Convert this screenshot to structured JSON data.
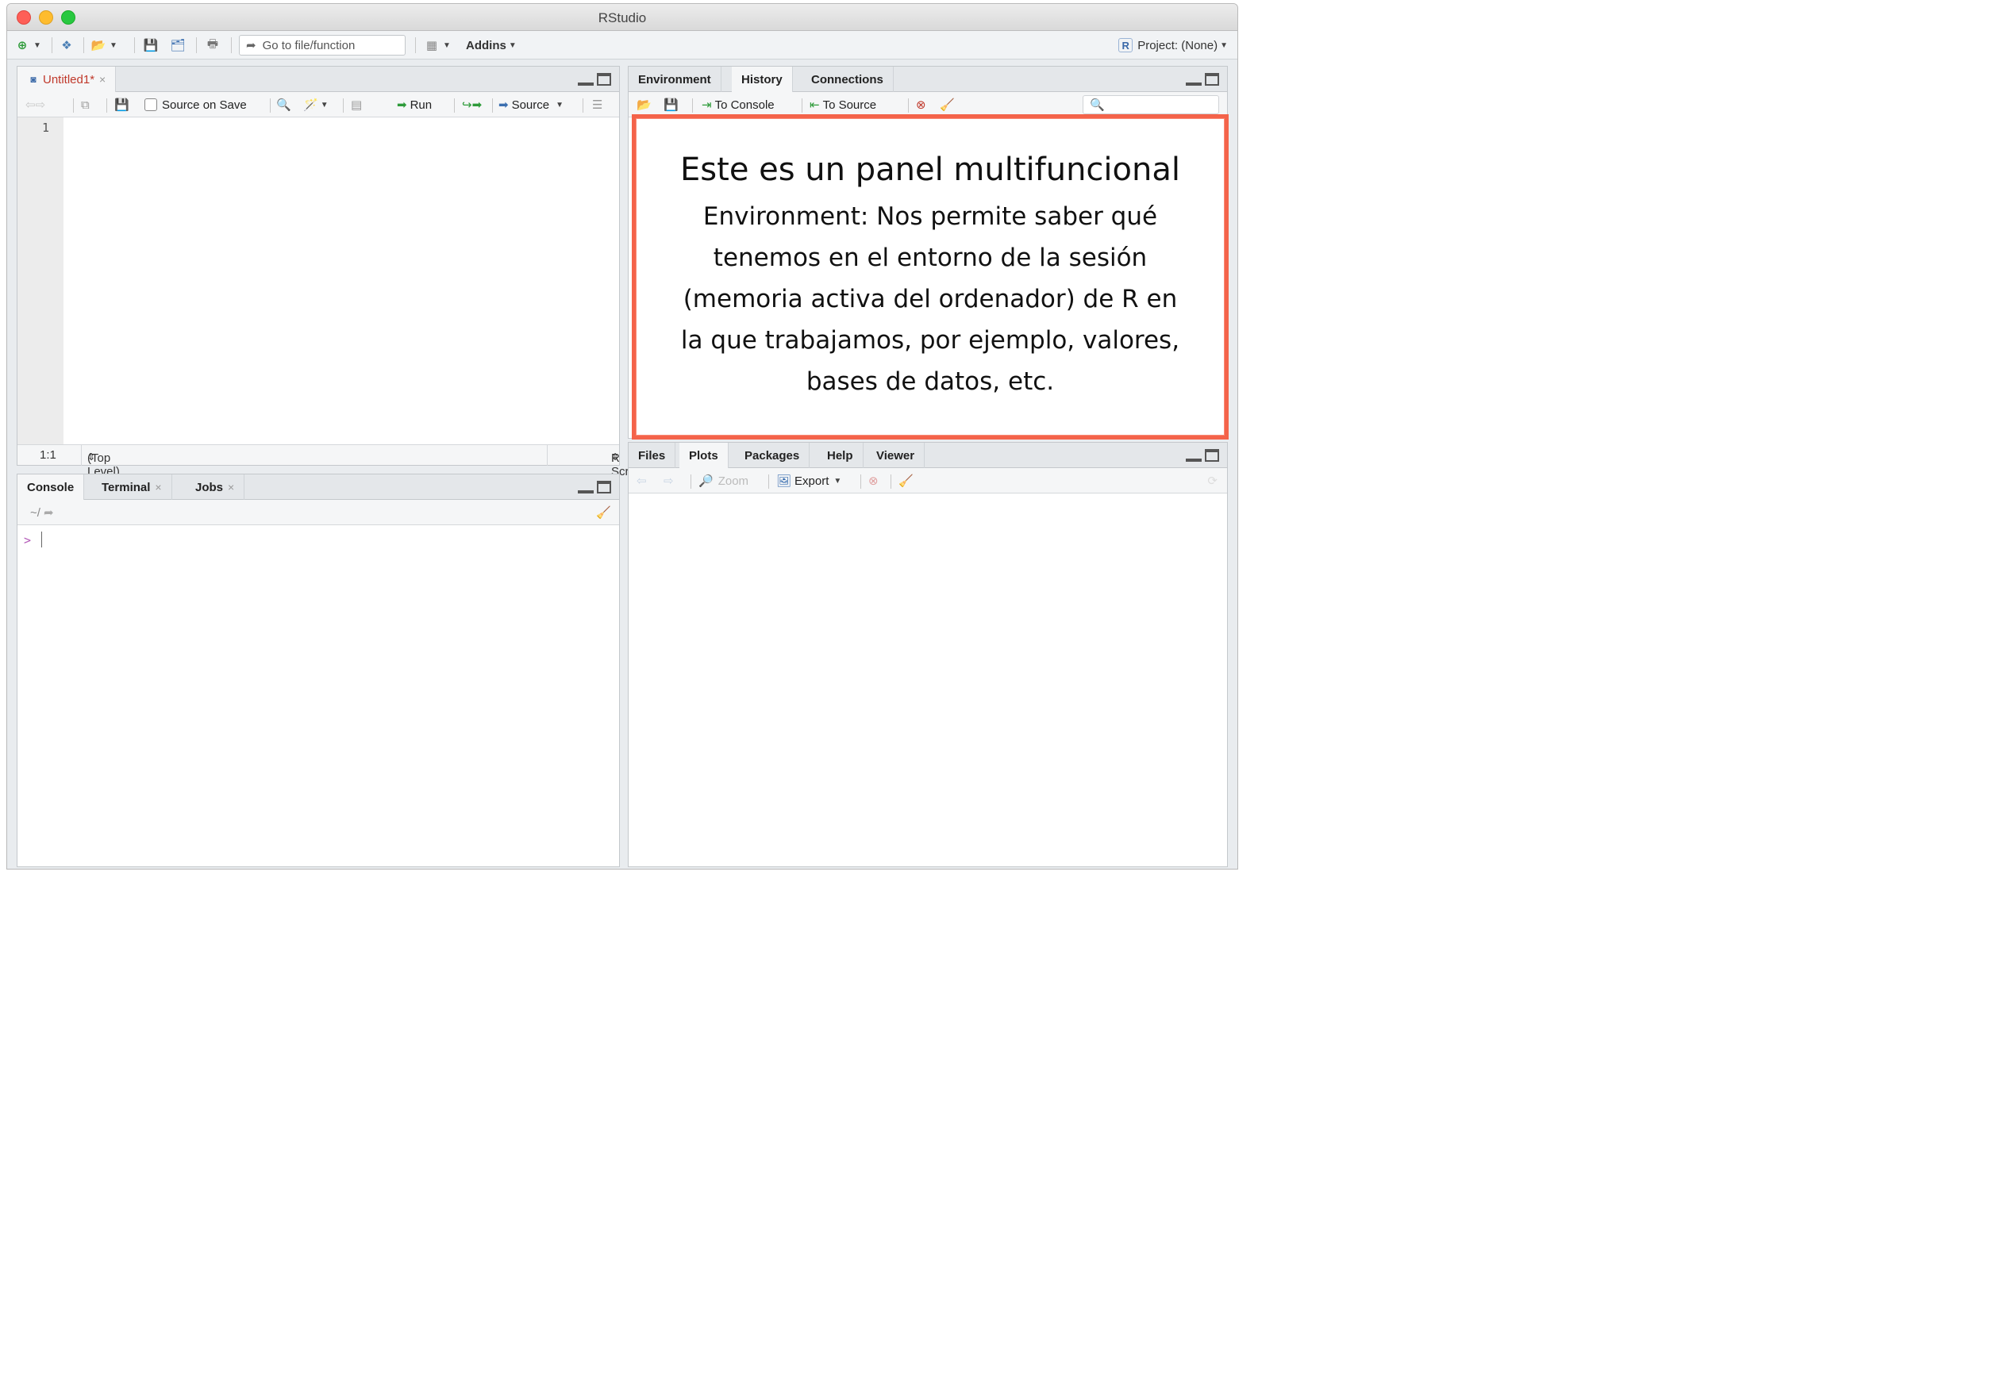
{
  "window": {
    "title": "RStudio"
  },
  "toolbar": {
    "goto_placeholder": "Go to file/function",
    "addins_label": "Addins",
    "project_label": "Project: (None)",
    "icons": [
      "new-file-icon",
      "new-project-icon",
      "open-file-icon",
      "save-icon",
      "save-all-icon",
      "print-icon",
      "grid-layout-icon"
    ]
  },
  "source_pane": {
    "tab_label": "Untitled1*",
    "source_on_save_label": "Source on Save",
    "run_label": "Run",
    "source_label": "Source",
    "line_numbers": [
      "1"
    ],
    "cursor_position": "1:1",
    "scope": "(Top Level)",
    "file_type": "R Script"
  },
  "console_pane": {
    "tabs": [
      "Console",
      "Terminal",
      "Jobs"
    ],
    "working_dir": "~/",
    "prompt": ">"
  },
  "env_pane": {
    "tabs": [
      "Environment",
      "History",
      "Connections"
    ],
    "to_console_label": "To Console",
    "to_source_label": "To Source",
    "search_placeholder": ""
  },
  "files_pane": {
    "tabs": [
      "Files",
      "Plots",
      "Packages",
      "Help",
      "Viewer"
    ],
    "zoom_label": "Zoom",
    "export_label": "Export"
  },
  "annotation": {
    "heading": "Este es un panel multifuncional",
    "lines": [
      "Environment: Nos permite saber qué",
      "tenemos en el entorno de la sesión",
      "(memoria activa del ordenador) de R en",
      "la que trabajamos, por ejemplo, valores,",
      "bases de datos, etc."
    ]
  },
  "colors": {
    "annotation_border": "#f4634a",
    "prompt": "#b35ab8",
    "source_tab_text": "#c0392b"
  }
}
